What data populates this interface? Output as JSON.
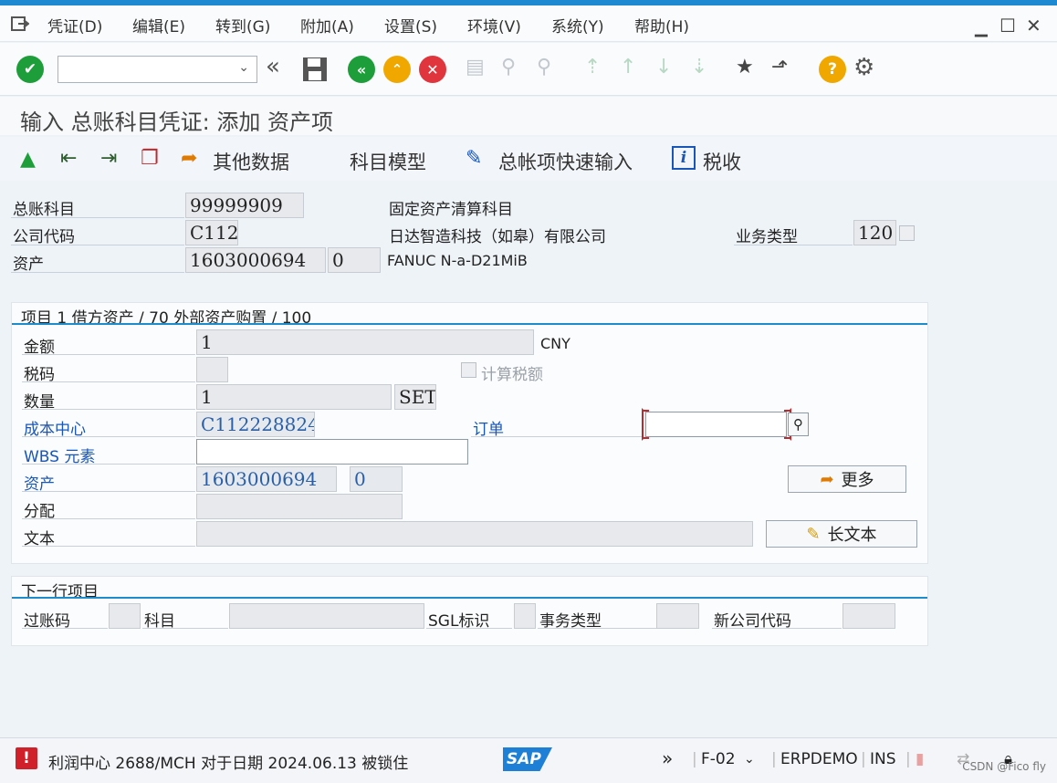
{
  "menu": {
    "items": [
      "凭证(D)",
      "编辑(E)",
      "转到(G)",
      "附加(A)",
      "设置(S)",
      "环境(V)",
      "系统(Y)",
      "帮助(H)"
    ]
  },
  "toolbar": {
    "command_field_value": "",
    "icons": [
      "enter-icon",
      "back-icon",
      "exit-icon",
      "cancel-icon",
      "print-icon",
      "find-icon",
      "find-next-icon",
      "first-page-icon",
      "prev-page-icon",
      "next-page-icon",
      "last-page-icon",
      "create-session-icon",
      "shortcut-icon",
      "help-icon",
      "customize-icon"
    ]
  },
  "title": "输入 总账科目凭证: 添加 资产项",
  "app_toolbar": {
    "other_data": "其他数据",
    "account_model": "科目模型",
    "fast_entry": "总帐项快速输入",
    "tax": "税收"
  },
  "header": {
    "gl_account_label": "总账科目",
    "gl_account_value": "99999909",
    "gl_account_desc": "固定资产清算科目",
    "company_code_label": "公司代码",
    "company_code_value": "C112",
    "company_name": "日达智造科技（如皋）有限公司",
    "trans_type_label": "业务类型",
    "trans_type_value": "120",
    "asset_label": "资产",
    "asset_value": "1603000694",
    "asset_sub": "0",
    "asset_desc": "FANUC N-a-D21MiB"
  },
  "item": {
    "heading": "项目 1 借方资产 / 70 外部资产购置 / 100",
    "amount_label": "金额",
    "amount_value": "1",
    "currency": "CNY",
    "tax_code_label": "税码",
    "tax_code_value": "",
    "calc_tax_label": "计算税额",
    "quantity_label": "数量",
    "quantity_value": "1",
    "unit": "SET",
    "cost_center_label": "成本中心",
    "cost_center_value": "C112228824",
    "order_label": "订单",
    "order_value": "",
    "wbs_label": "WBS 元素",
    "wbs_value": "",
    "asset_label": "资产",
    "asset_value": "1603000694",
    "asset_sub": "0",
    "more_button": "更多",
    "assignment_label": "分配",
    "assignment_value": "",
    "text_label": "文本",
    "text_value": "",
    "long_text_button": "长文本"
  },
  "next_line": {
    "heading": "下一行项目",
    "posting_key_label": "过账码",
    "account_label": "科目",
    "sgl_label": "SGL标识",
    "trans_type_label": "事务类型",
    "new_company_label": "新公司代码"
  },
  "status": {
    "message": "利润中心 2688/MCH 对于日期 2024.06.13 被锁住",
    "tcode": "F-02",
    "system": "ERPDEMO",
    "mode": "INS",
    "watermark": "CSDN @Fico fly"
  },
  "colors": {
    "accent": "#1e88d0",
    "error": "#d0202a",
    "ok_green": "#1e9e3a",
    "back_yellow": "#f0a800",
    "cancel_red": "#e0353c"
  }
}
